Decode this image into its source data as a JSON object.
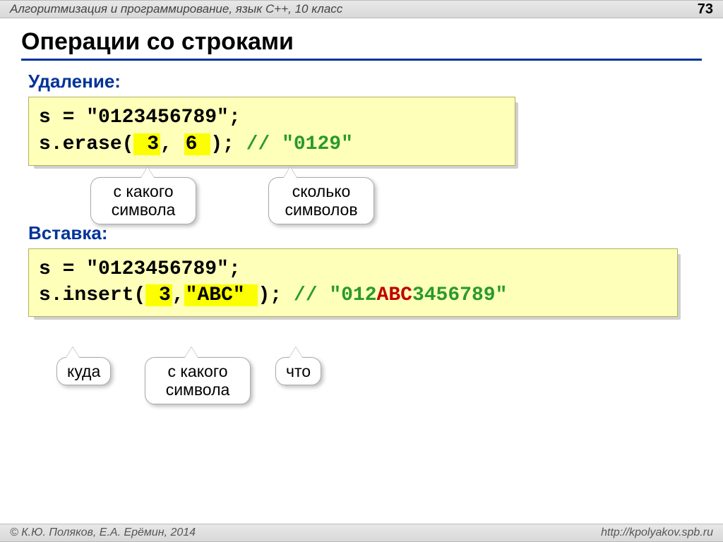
{
  "header": {
    "subject": "Алгоритмизация и программирование, язык C++, 10 класс",
    "page": "73"
  },
  "title": "Операции со строками",
  "section1": {
    "label": "Удаление:",
    "code": {
      "line1_a": "s = ",
      "line1_b": "\"0123456789\"",
      "line1_c": ";",
      "line2_a": "s.erase(",
      "line2_hl1": " 3",
      "line2_mid": ", ",
      "line2_hl2": "6 ",
      "line2_b": "); ",
      "line2_comment": "// \"0129\""
    },
    "callouts": {
      "c1": "с какого символа",
      "c2": "сколько символов"
    }
  },
  "section2": {
    "label": "Вставка:",
    "code": {
      "line1_a": "s = ",
      "line1_b": "\"0123456789\"",
      "line1_c": ";",
      "line2_a": "s.insert(",
      "line2_hl1": " 3",
      "line2_mid": ",",
      "line2_hl2": "\"ABC\" ",
      "line2_b": "); ",
      "comment_a": "// \"012",
      "comment_red": "ABC",
      "comment_b": "3456789\""
    },
    "callouts": {
      "c1": "куда",
      "c2": "с какого символа",
      "c3": "что"
    }
  },
  "footer": {
    "left": "© К.Ю. Поляков, Е.А. Ерёмин, 2014",
    "right": "http://kpolyakov.spb.ru"
  }
}
